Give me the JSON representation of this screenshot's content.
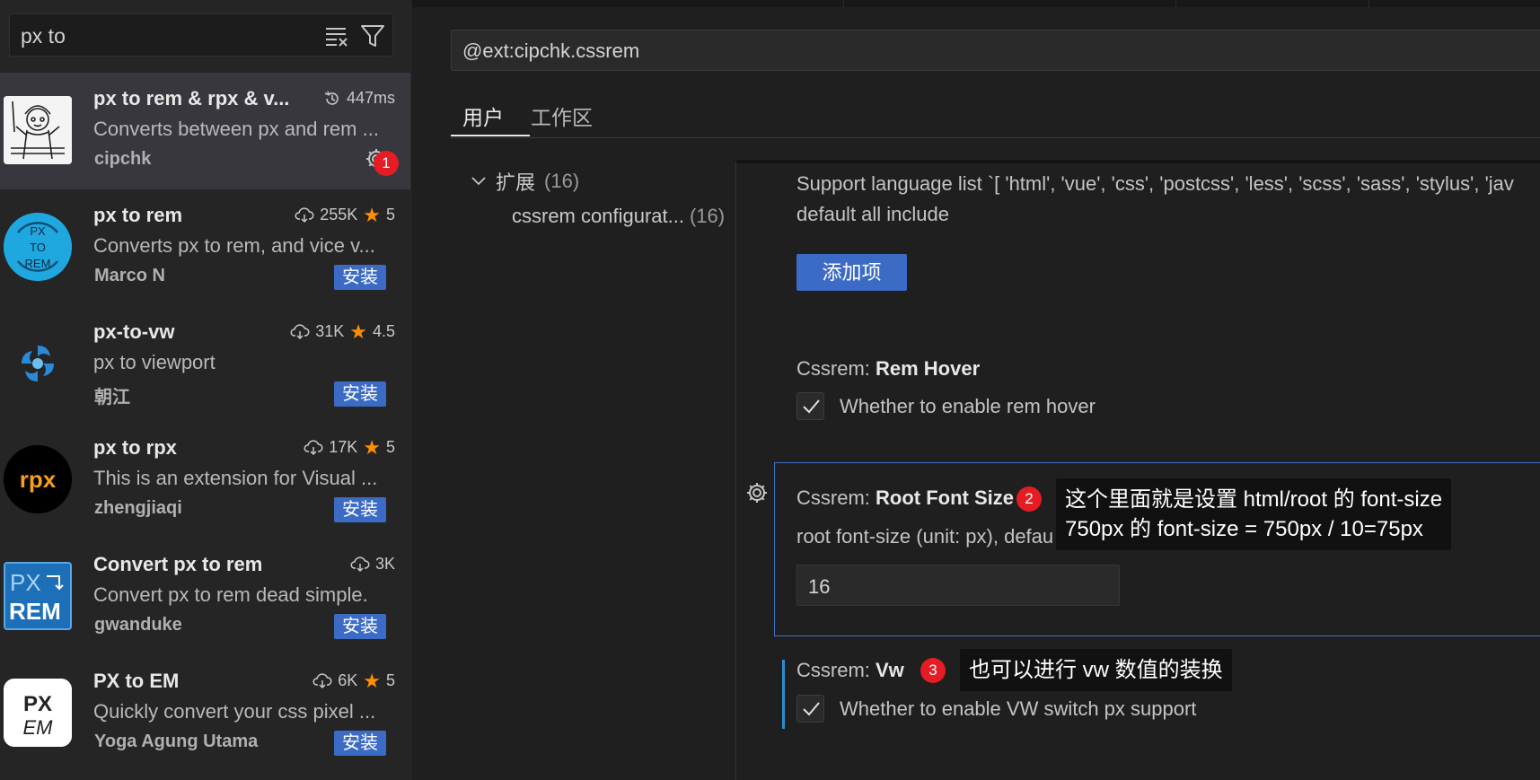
{
  "sidebar": {
    "search_query": "px to",
    "extensions": [
      {
        "name": "px to rem & rpx & v...",
        "description": "Converts between px and rem ...",
        "publisher": "cipchk",
        "stat": "447ms",
        "stat_kind": "activation-time",
        "badge": "1",
        "selected": true
      },
      {
        "name": "px to rem",
        "description": "Converts px to rem, and vice v...",
        "publisher": "Marco N",
        "downloads": "255K",
        "rating": "5",
        "install_label": "安装"
      },
      {
        "name": "px-to-vw",
        "description": "px to viewport",
        "publisher": "朝江",
        "downloads": "31K",
        "rating": "4.5",
        "install_label": "安装"
      },
      {
        "name": "px to rpx",
        "description": "This is an extension for Visual ...",
        "publisher": "zhengjiaqi",
        "downloads": "17K",
        "rating": "5",
        "install_label": "安装"
      },
      {
        "name": "Convert px to rem",
        "description": "Convert px to rem dead simple.",
        "publisher": "gwanduke",
        "downloads": "3K",
        "install_label": "安装"
      },
      {
        "name": "PX to EM",
        "description": "Quickly convert your css pixel ...",
        "publisher": "Yoga Agung Utama",
        "downloads": "6K",
        "rating": "5",
        "install_label": "安装"
      }
    ],
    "logos": {
      "px_to_rem_text": [
        "PX",
        "TO",
        "REM"
      ],
      "rpx_text": "rpx",
      "convert_text": [
        "PX",
        "REM"
      ],
      "em_text": [
        "PX",
        "EM"
      ]
    }
  },
  "settings": {
    "search_value": "@ext:cipchk.cssrem",
    "tabs": [
      {
        "label": "用户",
        "active": true
      },
      {
        "label": "工作区",
        "active": false
      }
    ],
    "toc": {
      "extensions_label": "扩展",
      "extensions_count": "(16)",
      "cssrem_label": "cssrem configurat...",
      "cssrem_count": "(16)"
    },
    "languages_desc_line1": "Support language list `[ 'html', 'vue', 'css', 'postcss', 'less', 'scss', 'sass', 'stylus', 'jav",
    "languages_desc_line2": "default all include",
    "add_item_label": "添加项",
    "rem_hover": {
      "category": "Cssrem: ",
      "title": "Rem Hover",
      "description": "Whether to enable rem hover",
      "checked": true
    },
    "root_font_size": {
      "category": "Cssrem: ",
      "title": "Root Font Size",
      "description": "root font-size (unit: px), defau",
      "value": "16"
    },
    "vw": {
      "category": "Cssrem: ",
      "title": "Vw",
      "description": "Whether to enable VW switch px support",
      "checked": true
    }
  },
  "annotations": {
    "badge2": "2",
    "badge3": "3",
    "tooltip2_line1": "这个里面就是设置 html/root 的 font-size",
    "tooltip2_line2": "750px 的 font-size = 750px / 10=75px",
    "tooltip3": "也可以进行 vw 数值的装换"
  },
  "colors": {
    "accent_blue": "#3b6bc4",
    "badge_red": "#e51c23",
    "star_orange": "#ff8e00",
    "focus_border": "#3e73c9",
    "modified_bar": "#2a8fcf"
  }
}
